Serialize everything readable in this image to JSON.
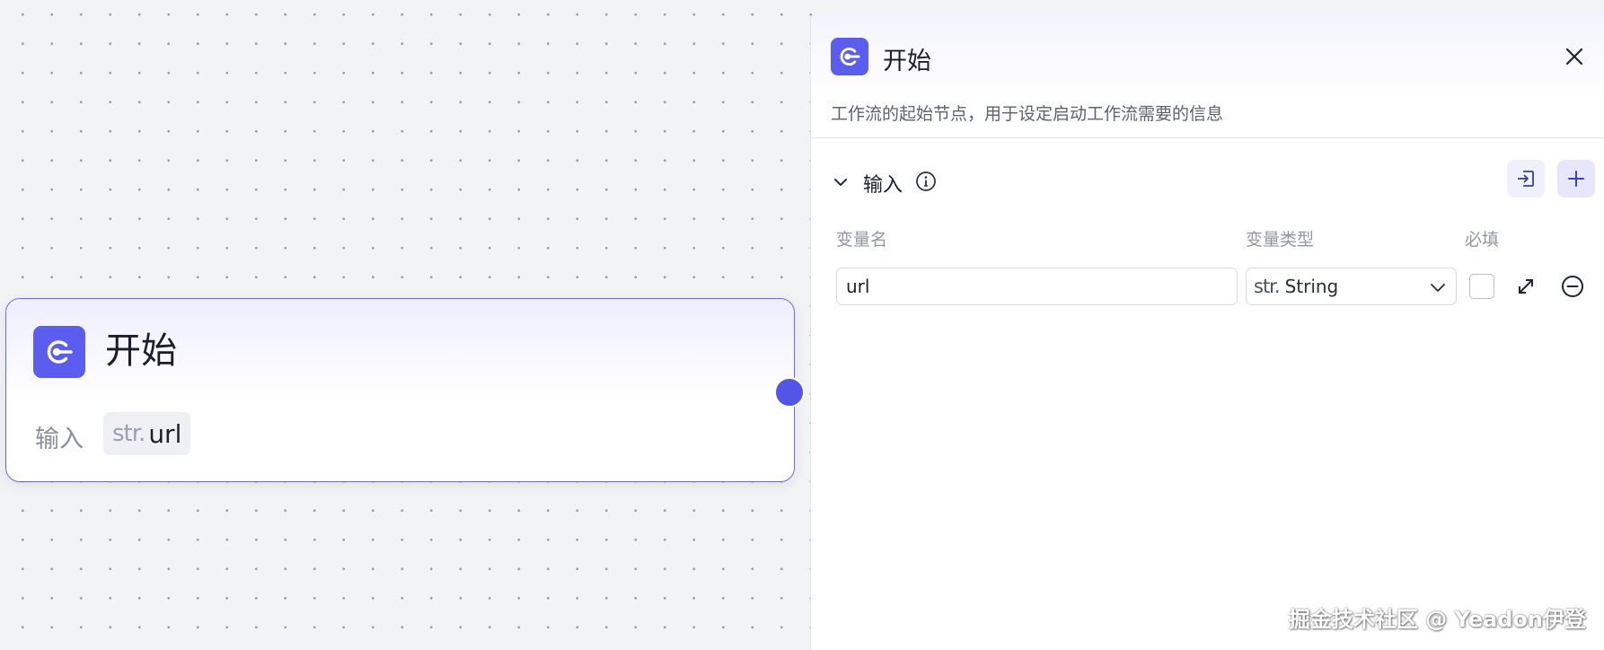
{
  "node": {
    "title": "开始",
    "input_label": "输入",
    "variables": [
      {
        "type_prefix": "str.",
        "name": "url"
      }
    ]
  },
  "panel": {
    "title": "开始",
    "description": "工作流的起始节点，用于设定启动工作流需要的信息",
    "section_title": "输入",
    "columns": {
      "name": "变量名",
      "type": "变量类型",
      "required": "必填"
    },
    "rows": [
      {
        "name_value": "url",
        "type_prefix": "str.",
        "type_value": "String",
        "required": false
      }
    ]
  },
  "watermark": "掘金技术社区 @ Yeadon伊登",
  "icons": {
    "node_icon": "start-node-icon",
    "close": "close-icon",
    "collapse": "chevron-down-icon",
    "info": "info-icon",
    "import": "import-icon",
    "add": "plus-icon",
    "expand": "expand-icon",
    "remove": "minus-circle-icon"
  },
  "colors": {
    "accent": "#5b5df0",
    "node_border": "#6a6de0",
    "handle": "#5155e8"
  }
}
